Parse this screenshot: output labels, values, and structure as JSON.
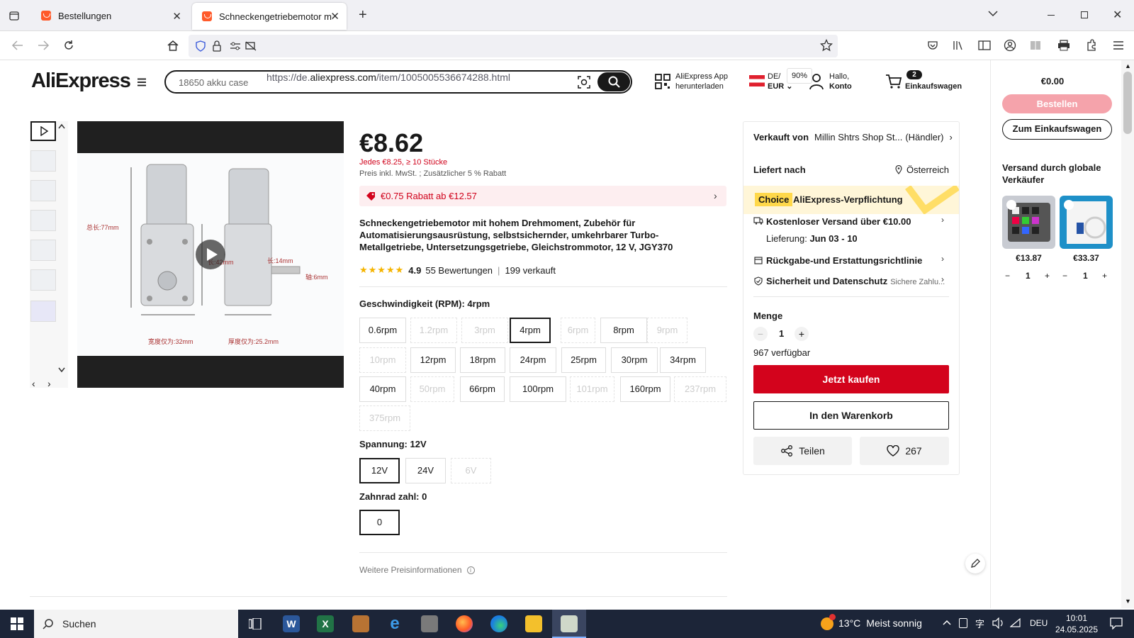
{
  "browser": {
    "tabs": [
      {
        "label": "Bestellungen"
      },
      {
        "label": "Schneckengetriebemotor mit ho"
      }
    ],
    "url_prefix": "https://de.",
    "url_domain": "aliexpress.com",
    "url_path": "/item/1005005536674288.html",
    "zoom": "90%"
  },
  "header": {
    "logo": "AliExpress",
    "search_value": "18650 akku case",
    "app_line1": "AliExpress App",
    "app_line2": "herunterladen",
    "locale_line1": "DE/",
    "locale_line2": "EUR",
    "account_line1": "Hallo,",
    "account_line2": "Konto",
    "cart_count": "2",
    "cart_label": "Einkaufswagen"
  },
  "gallery": {
    "labels": [
      "总长:77mm",
      "长:42mm",
      "长:14mm",
      "轴:6mm",
      "宽度仅为:32mm",
      "厚度仅为:25.2mm"
    ]
  },
  "product": {
    "price": "€8.62",
    "bulk_price": "Jedes €8.25, ≥ 10 Stücke",
    "tax_note": "Preis inkl. MwSt. ; Zusätzlicher 5 % Rabatt",
    "discount": "€0.75 Rabatt ab €12.57",
    "title": "Schneckengetriebemotor mit hohem Drehmoment, Zubehör für Automatisierungsausrüstung, selbstsichernder, umkehrbarer Turbo-Metallgetriebe, Untersetzungsgetriebe, Gleichstrommotor, 12 V, JGY370",
    "rating": "4.9",
    "reviews": "55 Bewertungen",
    "sold": "199 verkauft",
    "speed_label": "Geschwindigkeit (RPM): 4rpm",
    "speeds": [
      {
        "label": "0.6rpm",
        "state": "normal"
      },
      {
        "label": "1.2rpm",
        "state": "disabled"
      },
      {
        "label": "3rpm",
        "state": "disabled"
      },
      {
        "label": "4rpm",
        "state": "selected"
      },
      {
        "label": "6rpm",
        "state": "disabled"
      },
      {
        "label": "8rpm",
        "state": "normal"
      },
      {
        "label": "9rpm",
        "state": "disabled"
      },
      {
        "label": "10rpm",
        "state": "disabled"
      },
      {
        "label": "12rpm",
        "state": "normal"
      },
      {
        "label": "18rpm",
        "state": "normal"
      },
      {
        "label": "24rpm",
        "state": "normal"
      },
      {
        "label": "25rpm",
        "state": "normal"
      },
      {
        "label": "30rpm",
        "state": "normal"
      },
      {
        "label": "34rpm",
        "state": "normal"
      },
      {
        "label": "40rpm",
        "state": "normal"
      },
      {
        "label": "50rpm",
        "state": "disabled"
      },
      {
        "label": "66rpm",
        "state": "normal"
      },
      {
        "label": "100rpm",
        "state": "normal"
      },
      {
        "label": "101rpm",
        "state": "disabled"
      },
      {
        "label": "160rpm",
        "state": "normal"
      },
      {
        "label": "237rpm",
        "state": "disabled"
      },
      {
        "label": "375rpm",
        "state": "disabled"
      }
    ],
    "voltage_label": "Spannung: 12V",
    "voltages": [
      {
        "label": "12V",
        "state": "selected"
      },
      {
        "label": "24V",
        "state": "normal"
      },
      {
        "label": "6V",
        "state": "disabled"
      }
    ],
    "gear_label": "Zahnrad zahl: 0",
    "gears": [
      {
        "label": "0",
        "state": "selected"
      }
    ],
    "more_price_info": "Weitere Preisinformationen"
  },
  "seller_panel": {
    "sold_by_label": "Verkauft von",
    "seller": "Millin Shtrs Shop St...",
    "seller_type": "(Händler)",
    "ship_to_label": "Liefert nach",
    "ship_to": "Österreich",
    "choice_badge": "Choice",
    "choice_text": "AliExpress-Verpflichtung",
    "free_shipping": "Kostenloser Versand über €10.00",
    "delivery_label": "Lieferung:",
    "delivery_dates": "Jun 03 - 10",
    "returns": "Rückgabe-und Erstattungsrichtlinie",
    "security": "Sicherheit und Datenschutz",
    "security_sub": "Sichere Zahlu...",
    "qty_label": "Menge",
    "qty": "1",
    "available": "967 verfügbar",
    "buy_now": "Jetzt kaufen",
    "add_to_cart": "In den Warenkorb",
    "share": "Teilen",
    "wishlist_count": "267"
  },
  "mini_cart": {
    "total": "€0.00",
    "order": "Bestellen",
    "to_cart": "Zum Einkaufswagen",
    "shipping_note": "Versand durch globale Verkäufer",
    "items": [
      {
        "price": "€13.87",
        "qty": "1"
      },
      {
        "price": "€33.37",
        "qty": "1"
      }
    ]
  },
  "taskbar": {
    "search": "Suchen",
    "weather_temp": "13°C",
    "weather_text": "Meist sonnig",
    "lang": "DEU",
    "time": "10:01",
    "date": "24.05.2025"
  },
  "colors": {
    "accent_red": "#d3031c",
    "price_red": "#d0021b",
    "taskbar": "#1c2538",
    "choice_bg": "#fff6d8"
  }
}
